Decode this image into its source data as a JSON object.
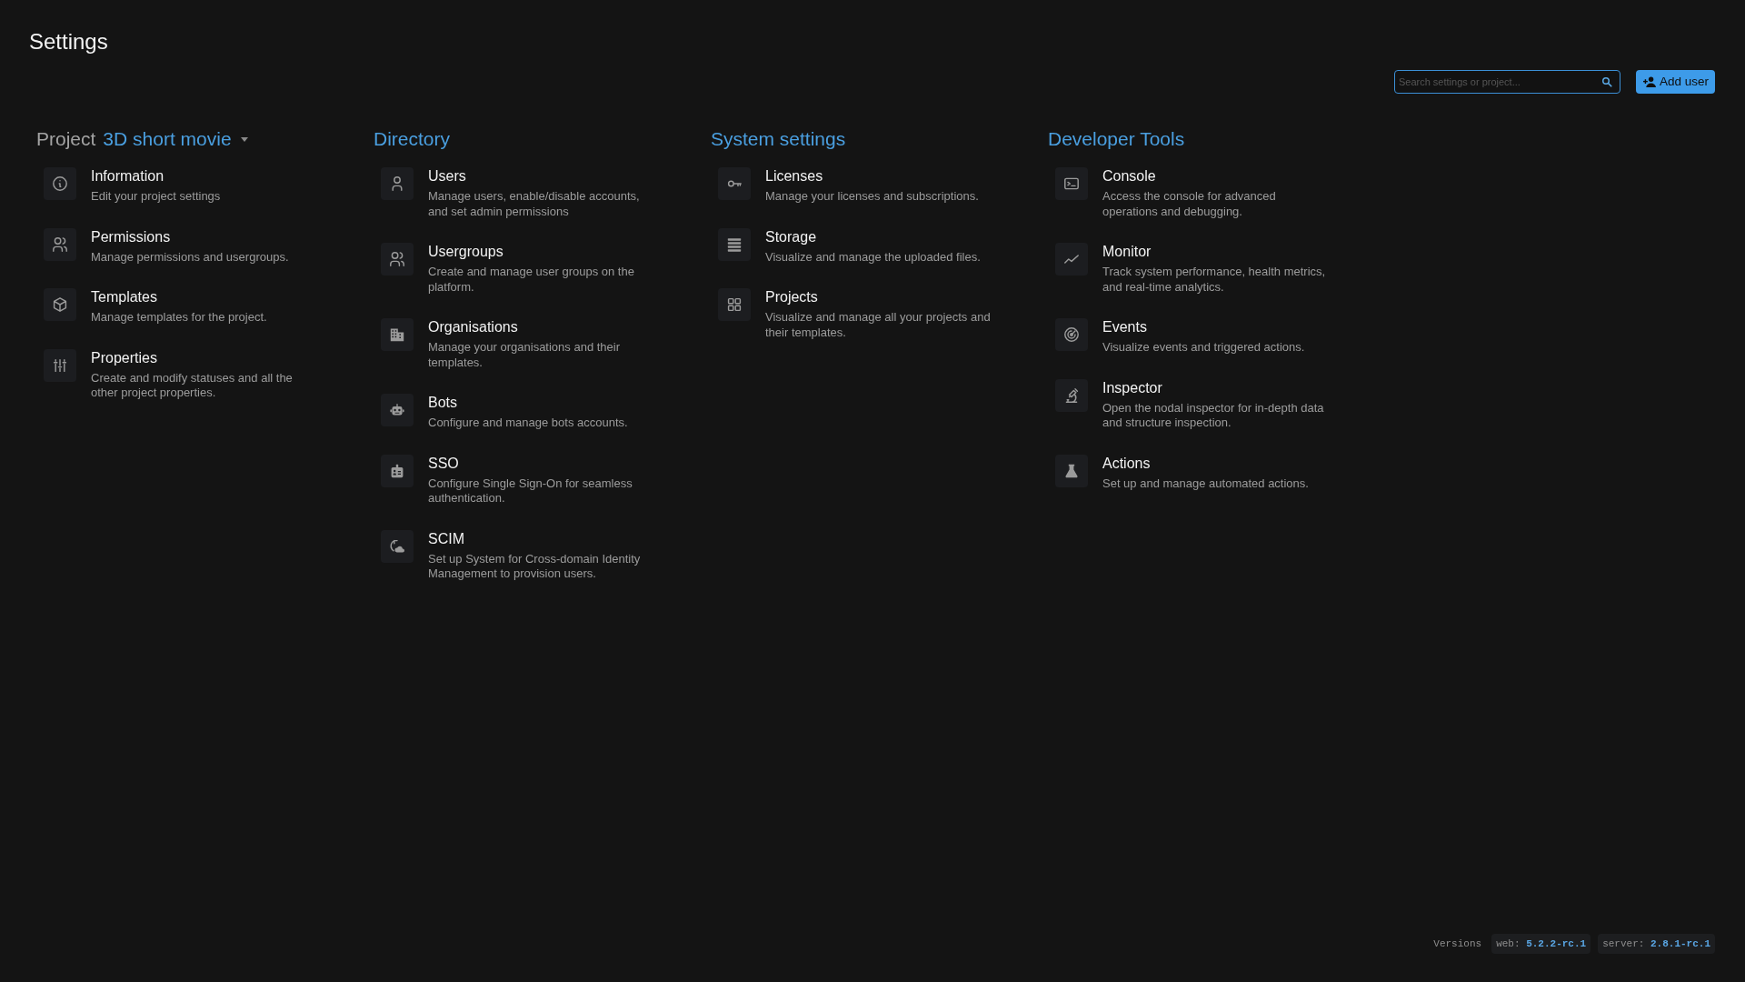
{
  "page": {
    "title": "Settings"
  },
  "toolbar": {
    "search": {
      "placeholder": "Search settings or project..."
    },
    "add_button": {
      "label": "Add user"
    }
  },
  "sections": [
    {
      "kind": "project",
      "label": "Project",
      "project": "3D short movie",
      "items": [
        {
          "title": "Information",
          "description": "Edit your project settings"
        },
        {
          "title": "Permissions",
          "description": "Manage permissions and usergroups."
        },
        {
          "title": "Templates",
          "description": "Manage templates for the project."
        },
        {
          "title": "Properties",
          "description": "Create and modify statuses and all the other project properties."
        }
      ]
    },
    {
      "kind": "group",
      "title": "Directory",
      "items": [
        {
          "title": "Users",
          "description": "Manage users, enable/disable accounts, and set admin permissions"
        },
        {
          "title": "Usergroups",
          "description": "Create and manage user groups on the platform."
        },
        {
          "title": "Organisations",
          "description": "Manage your organisations and their templates."
        },
        {
          "title": "Bots",
          "description": "Configure and manage bots accounts."
        },
        {
          "title": "SSO",
          "description": "Configure Single Sign-On for seamless authentication."
        },
        {
          "title": "SCIM",
          "description": "Set up System for Cross-domain Identity Management to provision users."
        }
      ]
    },
    {
      "kind": "group",
      "title": "System settings",
      "items": [
        {
          "title": "Licenses",
          "description": "Manage your licenses and subscriptions."
        },
        {
          "title": "Storage",
          "description": "Visualize and manage the uploaded files."
        },
        {
          "title": "Projects",
          "description": "Visualize and manage all your projects and their templates."
        }
      ]
    },
    {
      "kind": "group",
      "title": "Developer Tools",
      "items": [
        {
          "title": "Console",
          "description": "Access the console for advanced operations and debugging."
        },
        {
          "title": "Monitor",
          "description": "Track system performance, health metrics, and real-time analytics."
        },
        {
          "title": "Events",
          "description": "Visualize events and triggered actions."
        },
        {
          "title": "Inspector",
          "description": "Open the nodal inspector for in-depth data and structure inspection."
        },
        {
          "title": "Actions",
          "description": "Set up and manage automated actions."
        }
      ]
    }
  ],
  "versions": {
    "label": "Versions",
    "entries": [
      {
        "key": "web:",
        "value": "5.2.2-rc.1"
      },
      {
        "key": "server:",
        "value": "2.8.1-rc.1"
      }
    ]
  }
}
